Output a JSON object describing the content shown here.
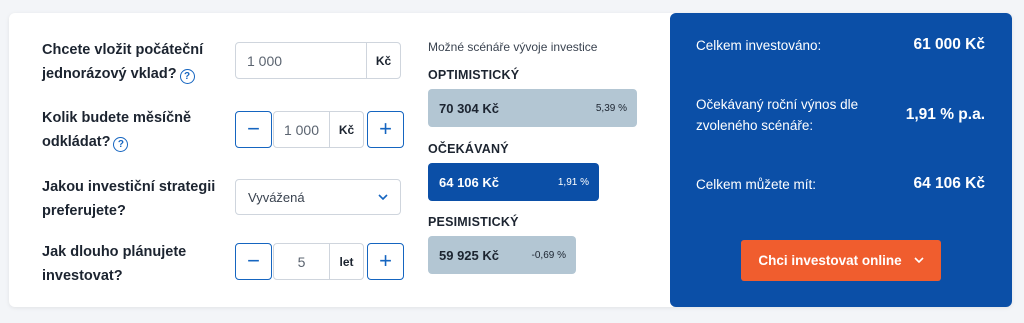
{
  "questions": {
    "q1_line1": "Chcete vložit počáteční",
    "q1_line2": "jednorázový vklad?",
    "q2_line1": "Kolik budete měsíčně",
    "q2_line2": "odkládat?",
    "q3_line1": "Jakou investiční strategii",
    "q3_line2": "preferujete?",
    "q4_line1": "Jak dlouho plánujete",
    "q4_line2": "investovat?"
  },
  "inputs": {
    "initial_value": "1 000",
    "initial_unit": "Kč",
    "monthly_value": "1 000",
    "monthly_unit": "Kč",
    "strategy_selected": "Vyvážená",
    "years_value": "5",
    "years_unit": "let"
  },
  "icons": {
    "help": "?",
    "minus": "−",
    "plus": "+",
    "chevron": "⌄"
  },
  "scenarios": {
    "title": "Možné scénáře vývoje investice",
    "items": [
      {
        "label": "OPTIMISTICKÝ",
        "amount": "70 304 Kč",
        "percent": "5,39 %",
        "bar_fraction": 1.0,
        "color": "#b3c6d3",
        "text_color": "#1c2430"
      },
      {
        "label": "OČEKÁVANÝ",
        "amount": "64 106 Kč",
        "percent": "1,91 %",
        "bar_fraction": 0.82,
        "color": "#0b4fa7",
        "text_color": "#ffffff"
      },
      {
        "label": "PESIMISTICKÝ",
        "amount": "59 925 Kč",
        "percent": "-0,69 %",
        "bar_fraction": 0.71,
        "color": "#b3c6d3",
        "text_color": "#1c2430"
      }
    ]
  },
  "summary": {
    "invested_label": "Celkem investováno:",
    "invested_value": "61 000 Kč",
    "yield_label_line1": "Očekávaný roční výnos dle",
    "yield_label_line2": "zvoleného scénáře:",
    "yield_value": "1,91 % p.a.",
    "total_label": "Celkem můžete mít:",
    "total_value": "64 106 Kč",
    "cta_label": "Chci investovat online"
  },
  "colors": {
    "accent": "#1565c0",
    "panel": "#0b4fa7",
    "cta": "#f05d2e"
  }
}
